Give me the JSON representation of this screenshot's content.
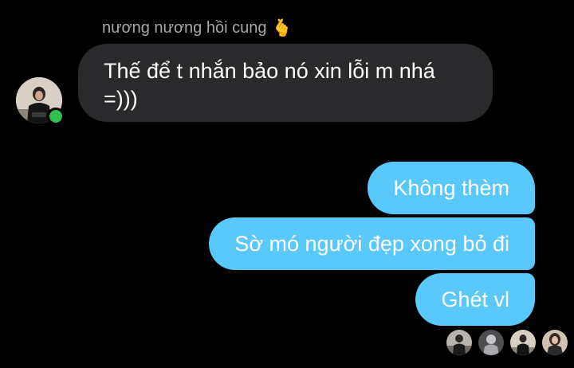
{
  "thread": {
    "sender": {
      "name": "nương nương hồi cung",
      "name_emoji": "🫰",
      "avatar_icon": "profile-photo",
      "online": true,
      "online_color": "#31c04b"
    },
    "incoming": [
      {
        "text": "Thế để t nhắn bảo nó xin lỗi m nhá =)))"
      }
    ],
    "outgoing": [
      {
        "text": "Không thèm"
      },
      {
        "text": "Sờ mó người đẹp xong bỏ đi"
      },
      {
        "text": "Ghét vl"
      }
    ],
    "seen_by": [
      {
        "icon": "profile-photo"
      },
      {
        "icon": "profile-photo"
      },
      {
        "icon": "profile-photo"
      },
      {
        "icon": "profile-photo"
      }
    ]
  },
  "colors": {
    "background": "#000000",
    "incoming_bubble": "#2a2a2c",
    "outgoing_bubble": "#5ac8fa",
    "sender_name": "#a8a8a8",
    "message_text": "#ffffff"
  }
}
